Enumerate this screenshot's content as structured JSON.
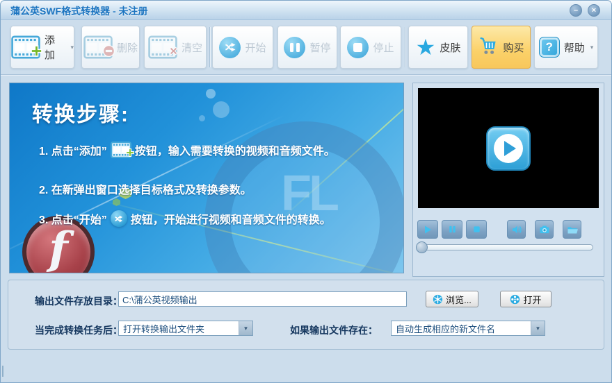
{
  "window": {
    "title": "蒲公英SWF格式转换器 - 未注册"
  },
  "icons": {
    "minimize": "–",
    "close": "×",
    "dropdown": "▾",
    "select_arrow": "▼",
    "star": "★",
    "help_mark": "?"
  },
  "toolbar": {
    "add": "添加",
    "delete": "删除",
    "clear": "清空",
    "start": "开始",
    "pause": "暂停",
    "stop": "停止",
    "skin": "皮肤",
    "buy": "购买",
    "help": "帮助"
  },
  "instructions": {
    "title": "转换步骤:",
    "step1_pre": "1. 点击“添加”",
    "step1_post": "按钮，输入需要转换的视频和音频文件。",
    "step2": "2. 在新弹出窗口选择目标格式及转换参数。",
    "step3_pre": "3. 点击“开始”",
    "step3_post": "按钮，开始进行视频和音频文件的转换。",
    "watermark": "FL",
    "flash_letter": "f"
  },
  "output": {
    "dir_label": "输出文件存放目录：",
    "dir_value": "C:\\蒲公英视频输出",
    "browse_label": "浏览...",
    "open_label": "打开"
  },
  "options": {
    "after_label": "当完成转换任务后：",
    "after_value": "打开转换输出文件夹",
    "exists_label": "如果输出文件存在：",
    "exists_value": "自动生成相应的新文件名"
  }
}
